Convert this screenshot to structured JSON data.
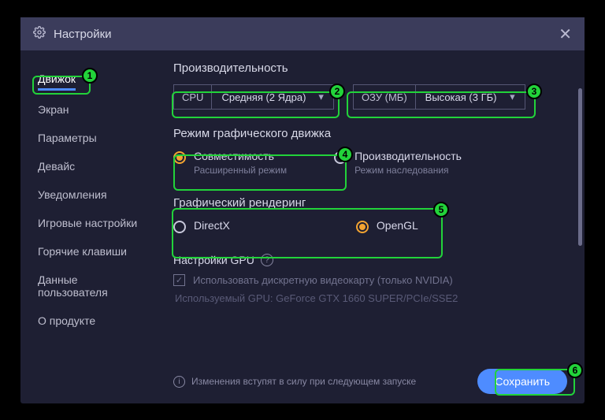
{
  "titlebar": {
    "title": "Настройки"
  },
  "sidebar": {
    "items": [
      {
        "label": "Движок"
      },
      {
        "label": "Экран"
      },
      {
        "label": "Параметры"
      },
      {
        "label": "Девайс"
      },
      {
        "label": "Уведомления"
      },
      {
        "label": "Игровые настройки"
      },
      {
        "label": "Горячие клавиши"
      },
      {
        "label": "Данные пользователя"
      },
      {
        "label": "О продукте"
      }
    ]
  },
  "perf": {
    "title": "Производительность",
    "cpu_label": "CPU",
    "cpu_value": "Средняя (2 Ядра)",
    "ram_label": "ОЗУ (МБ)",
    "ram_value": "Высокая (3 ГБ)"
  },
  "engine_mode": {
    "title": "Режим графического движка",
    "options": [
      {
        "main": "Совместимость",
        "sub": "Расширенный режим",
        "selected": true
      },
      {
        "main": "Производительность",
        "sub": "Режим наследования",
        "selected": false
      }
    ]
  },
  "rendering": {
    "title": "Графический рендеринг",
    "options": [
      {
        "main": "DirectX",
        "selected": false
      },
      {
        "main": "OpenGL",
        "selected": true
      }
    ]
  },
  "gpu": {
    "title": "Настройки GPU",
    "checkbox_label": "Использовать дискретную видеокарту (только NVIDIA)",
    "used_label": "Используемый GPU: GeForce GTX 1660 SUPER/PCIe/SSE2"
  },
  "footer": {
    "notice": "Изменения вступят в силу при следующем запуске",
    "save": "Сохранить"
  },
  "annotations": [
    "1",
    "2",
    "3",
    "4",
    "5",
    "6"
  ]
}
